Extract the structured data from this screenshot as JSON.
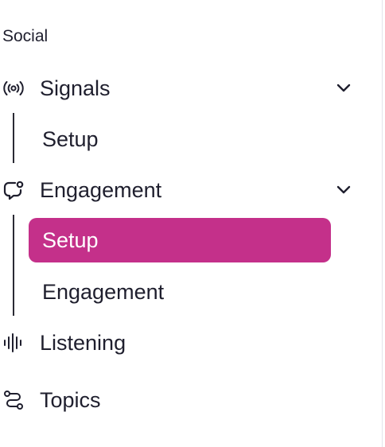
{
  "sidebar": {
    "section_heading": "Social",
    "active_color": "#c4308a",
    "groups": [
      {
        "label": "Signals",
        "icon": "broadcast-icon",
        "expanded": true,
        "children": [
          {
            "label": "Setup",
            "active": false
          }
        ]
      },
      {
        "label": "Engagement",
        "icon": "chat-bubble-icon",
        "expanded": true,
        "children": [
          {
            "label": "Setup",
            "active": true
          },
          {
            "label": "Engagement",
            "active": false
          }
        ]
      }
    ],
    "items": [
      {
        "label": "Listening",
        "icon": "sound-wave-icon"
      },
      {
        "label": "Topics",
        "icon": "route-icon"
      }
    ]
  }
}
